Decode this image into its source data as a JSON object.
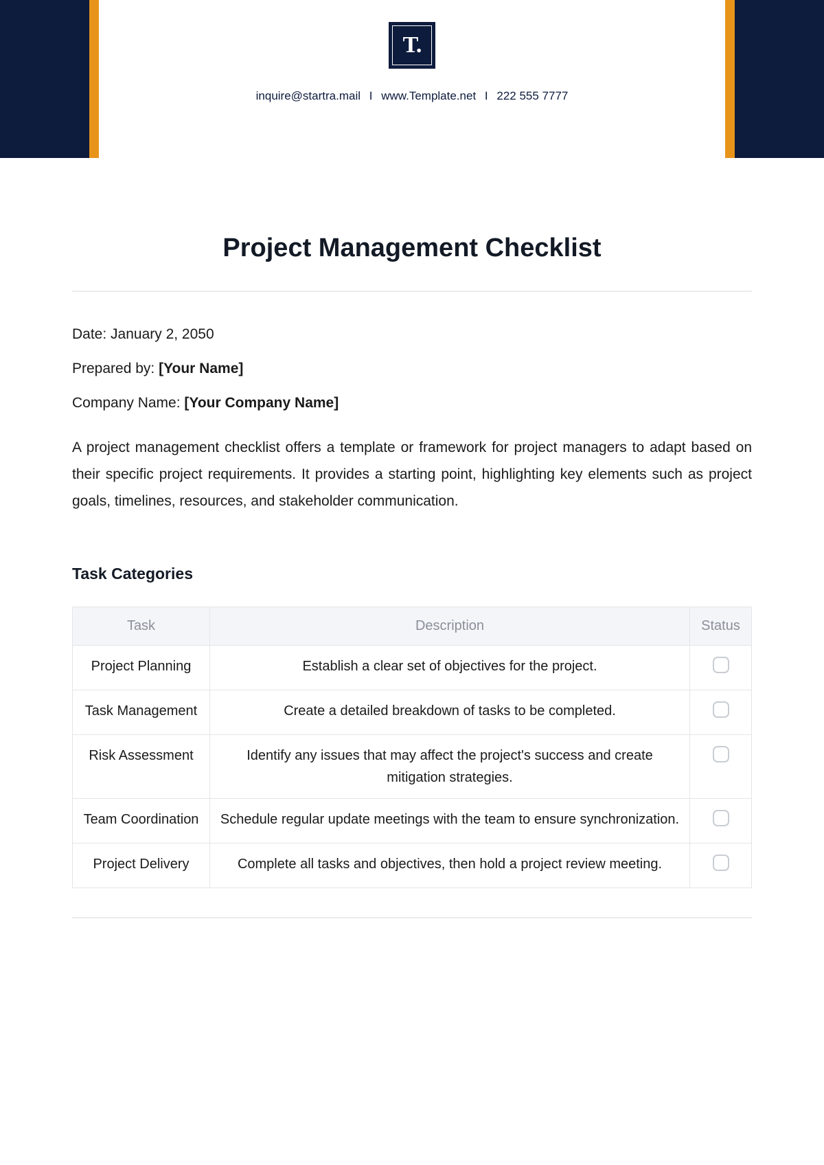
{
  "header": {
    "logo_text": "T.",
    "email": "inquire@startra.mail",
    "website": "www.Template.net",
    "phone": "222 555 7777",
    "separator": "I"
  },
  "title": "Project Management Checklist",
  "meta": {
    "date_label": "Date: ",
    "date_value": "January 2, 2050",
    "prepared_label": "Prepared by: ",
    "prepared_value": "[Your Name]",
    "company_label": "Company Name: ",
    "company_value": "[Your Company Name]"
  },
  "intro": "A project management checklist offers a template or framework for project managers to adapt based on their specific project requirements. It provides a starting point, highlighting key elements such as project goals, timelines, resources, and stakeholder communication.",
  "section_heading": "Task Categories",
  "table": {
    "headers": {
      "task": "Task",
      "description": "Description",
      "status": "Status"
    },
    "rows": [
      {
        "task": "Project Planning",
        "description": "Establish a clear set of objectives for the project."
      },
      {
        "task": "Task Management",
        "description": "Create a detailed breakdown of tasks to be completed."
      },
      {
        "task": "Risk Assessment",
        "description": "Identify any issues that may affect the project's success and create mitigation strategies."
      },
      {
        "task": "Team Coordination",
        "description": "Schedule regular update meetings with the team to ensure synchronization."
      },
      {
        "task": "Project Delivery",
        "description": "Complete all tasks and objectives, then hold a project review meeting."
      }
    ]
  }
}
